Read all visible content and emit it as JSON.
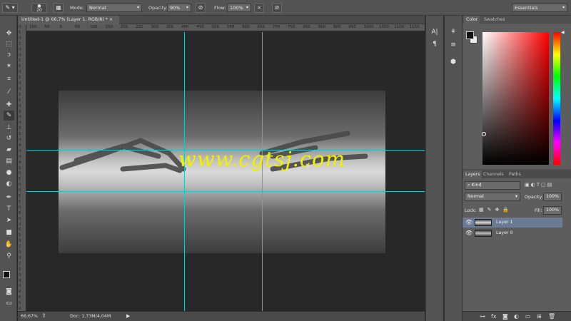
{
  "options_bar": {
    "brush_size": "20",
    "mode_label": "Mode:",
    "mode_value": "Normal",
    "opacity_label": "Opacity:",
    "opacity_value": "90%",
    "flow_label": "Flow:",
    "flow_value": "100%",
    "workspace": "Essentials"
  },
  "document": {
    "tab_title": "Untitled-1 @ 66,7% (Layer 1, RGB/8) *",
    "watermark": "www.cgtsj.com"
  },
  "ruler": {
    "top_labels": [
      "100",
      "50",
      "0",
      "50",
      "100",
      "150",
      "200",
      "250",
      "300",
      "350",
      "400",
      "450",
      "500",
      "550",
      "600",
      "650",
      "700",
      "750",
      "800",
      "850",
      "900",
      "950",
      "1000",
      "1050",
      "1100",
      "1150"
    ],
    "left_labels": [
      "0",
      "5",
      "0",
      "1",
      "0",
      "0",
      "1",
      "5",
      "0",
      "2",
      "0",
      "0",
      "2",
      "5",
      "0",
      "3",
      "0",
      "0",
      "3",
      "5",
      "0",
      "4",
      "0",
      "0",
      "4",
      "5",
      "0",
      "5",
      "0",
      "0",
      "5",
      "5",
      "0",
      "6",
      "0",
      "0",
      "6",
      "5",
      "0",
      "7",
      "0",
      "0",
      "7",
      "5",
      "0",
      "8",
      "0",
      "0",
      "8",
      "5",
      "0"
    ]
  },
  "status": {
    "zoom": "66,67%",
    "doc_info": "Doc: 1,73M/4,04M"
  },
  "color_panel": {
    "tabs": [
      "Color",
      "Swatches"
    ],
    "hue_color": "#ff0000"
  },
  "layers_panel": {
    "tabs": [
      "Layers",
      "Channels",
      "Paths"
    ],
    "filter_value": "Kind",
    "blend_mode": "Normal",
    "opacity_label": "Opacity:",
    "opacity_value": "100%",
    "lock_label": "Lock:",
    "fill_label": "Fill:",
    "fill_value": "100%",
    "layers": [
      {
        "name": "Layer 1",
        "selected": true
      },
      {
        "name": "Layer 0",
        "selected": false
      }
    ],
    "selected_color": "#6a7b93"
  },
  "guide_color": "#22c3c3",
  "watermark_color": "#f0f000"
}
